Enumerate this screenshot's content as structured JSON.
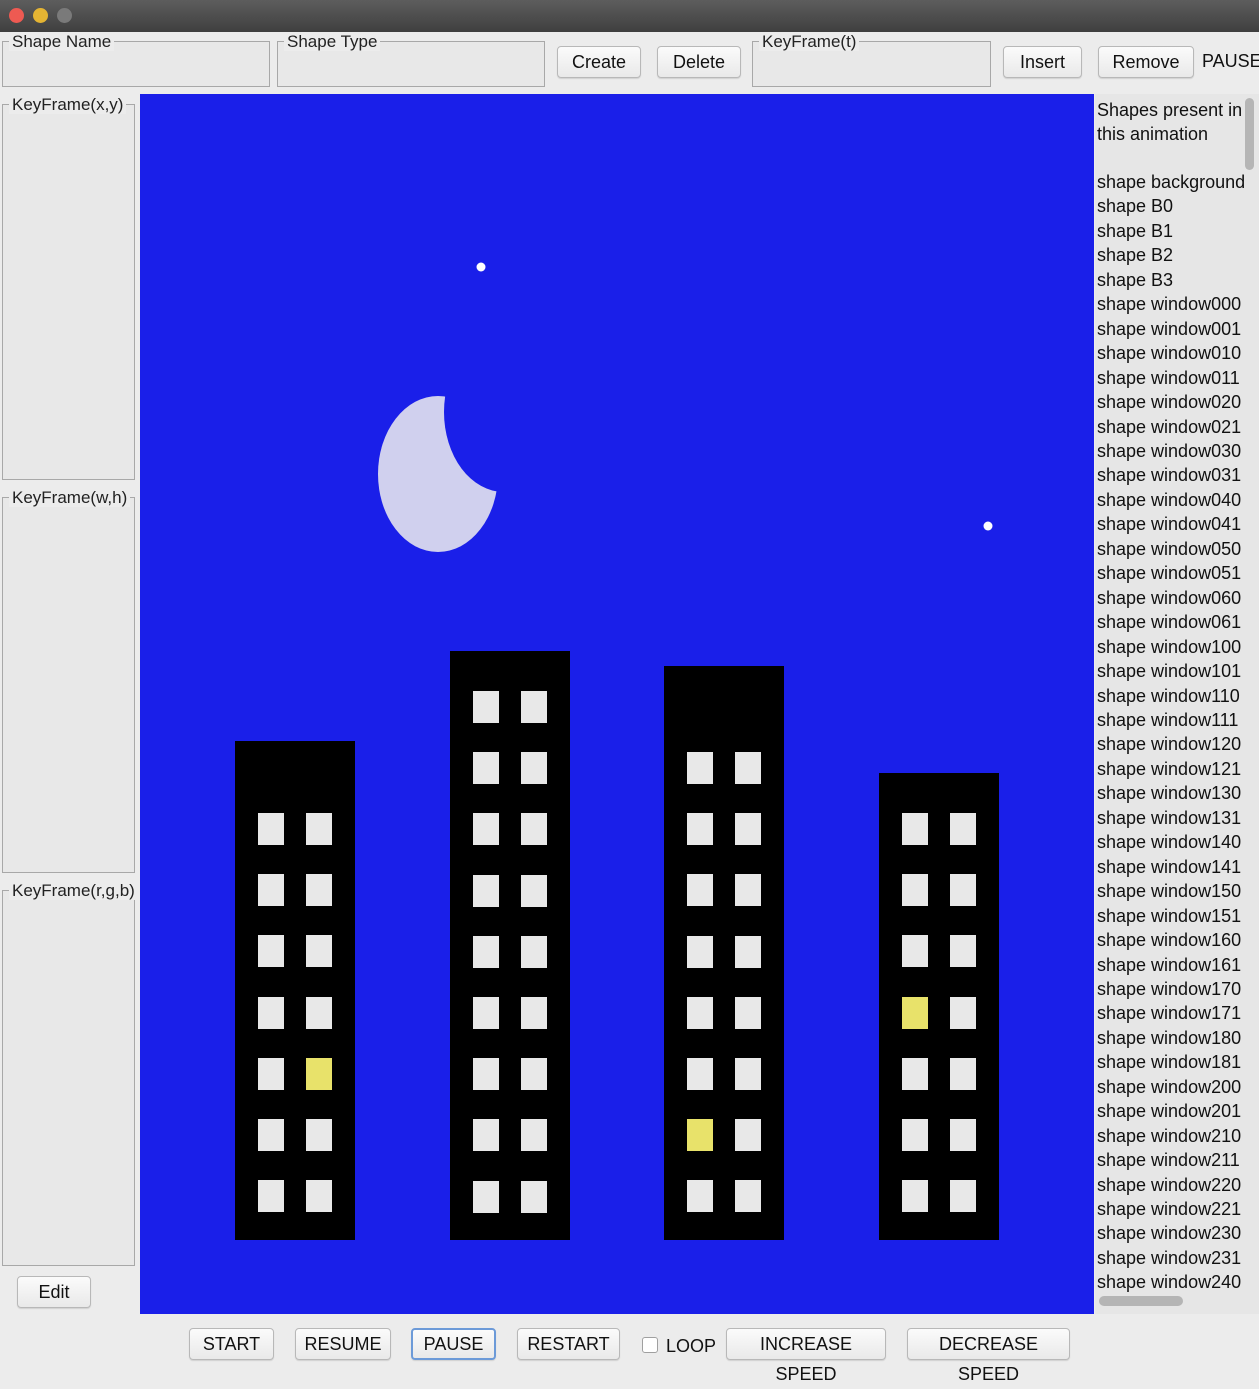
{
  "window": {
    "controls": [
      "close",
      "minimize",
      "zoom"
    ]
  },
  "toolbar": {
    "shape_name_legend": "Shape Name",
    "shape_name_value": "",
    "shape_type_legend": "Shape Type",
    "shape_type_value": "",
    "create_label": "Create",
    "delete_label": "Delete",
    "keyframe_t_legend": "KeyFrame(t)",
    "keyframe_t_value": "",
    "insert_label": "Insert",
    "remove_label": "Remove",
    "status": "PAUSED"
  },
  "left_panel": {
    "keyframe_xy_legend": "KeyFrame(x,y)",
    "keyframe_wh_legend": "KeyFrame(w,h)",
    "keyframe_rgb_legend": "KeyFrame(r,g,b)",
    "edit_label": "Edit"
  },
  "canvas": {
    "background_color": "#1a1fe9",
    "moon_color": "#d0d0ee",
    "star_color": "#ffffff",
    "building_color": "#000000",
    "window_color": "#e8e8e8",
    "lit_window_color": "#e8e26a"
  },
  "shape_list": {
    "heading": "Shapes present in this animation",
    "items": [
      "shape background",
      "shape B0",
      "shape B1",
      "shape B2",
      "shape B3",
      "shape window000",
      "shape window001",
      "shape window010",
      "shape window011",
      "shape window020",
      "shape window021",
      "shape window030",
      "shape window031",
      "shape window040",
      "shape window041",
      "shape window050",
      "shape window051",
      "shape window060",
      "shape window061",
      "shape window100",
      "shape window101",
      "shape window110",
      "shape window111",
      "shape window120",
      "shape window121",
      "shape window130",
      "shape window131",
      "shape window140",
      "shape window141",
      "shape window150",
      "shape window151",
      "shape window160",
      "shape window161",
      "shape window170",
      "shape window171",
      "shape window180",
      "shape window181",
      "shape window200",
      "shape window201",
      "shape window210",
      "shape window211",
      "shape window220",
      "shape window221",
      "shape window230",
      "shape window231",
      "shape window240"
    ]
  },
  "controls": {
    "start_label": "START",
    "resume_label": "RESUME",
    "pause_label": "PAUSE",
    "restart_label": "RESTART",
    "loop_label": "LOOP",
    "loop_checked": false,
    "increase_speed_label": "INCREASE SPEED",
    "decrease_speed_label": "DECREASE SPEED"
  }
}
